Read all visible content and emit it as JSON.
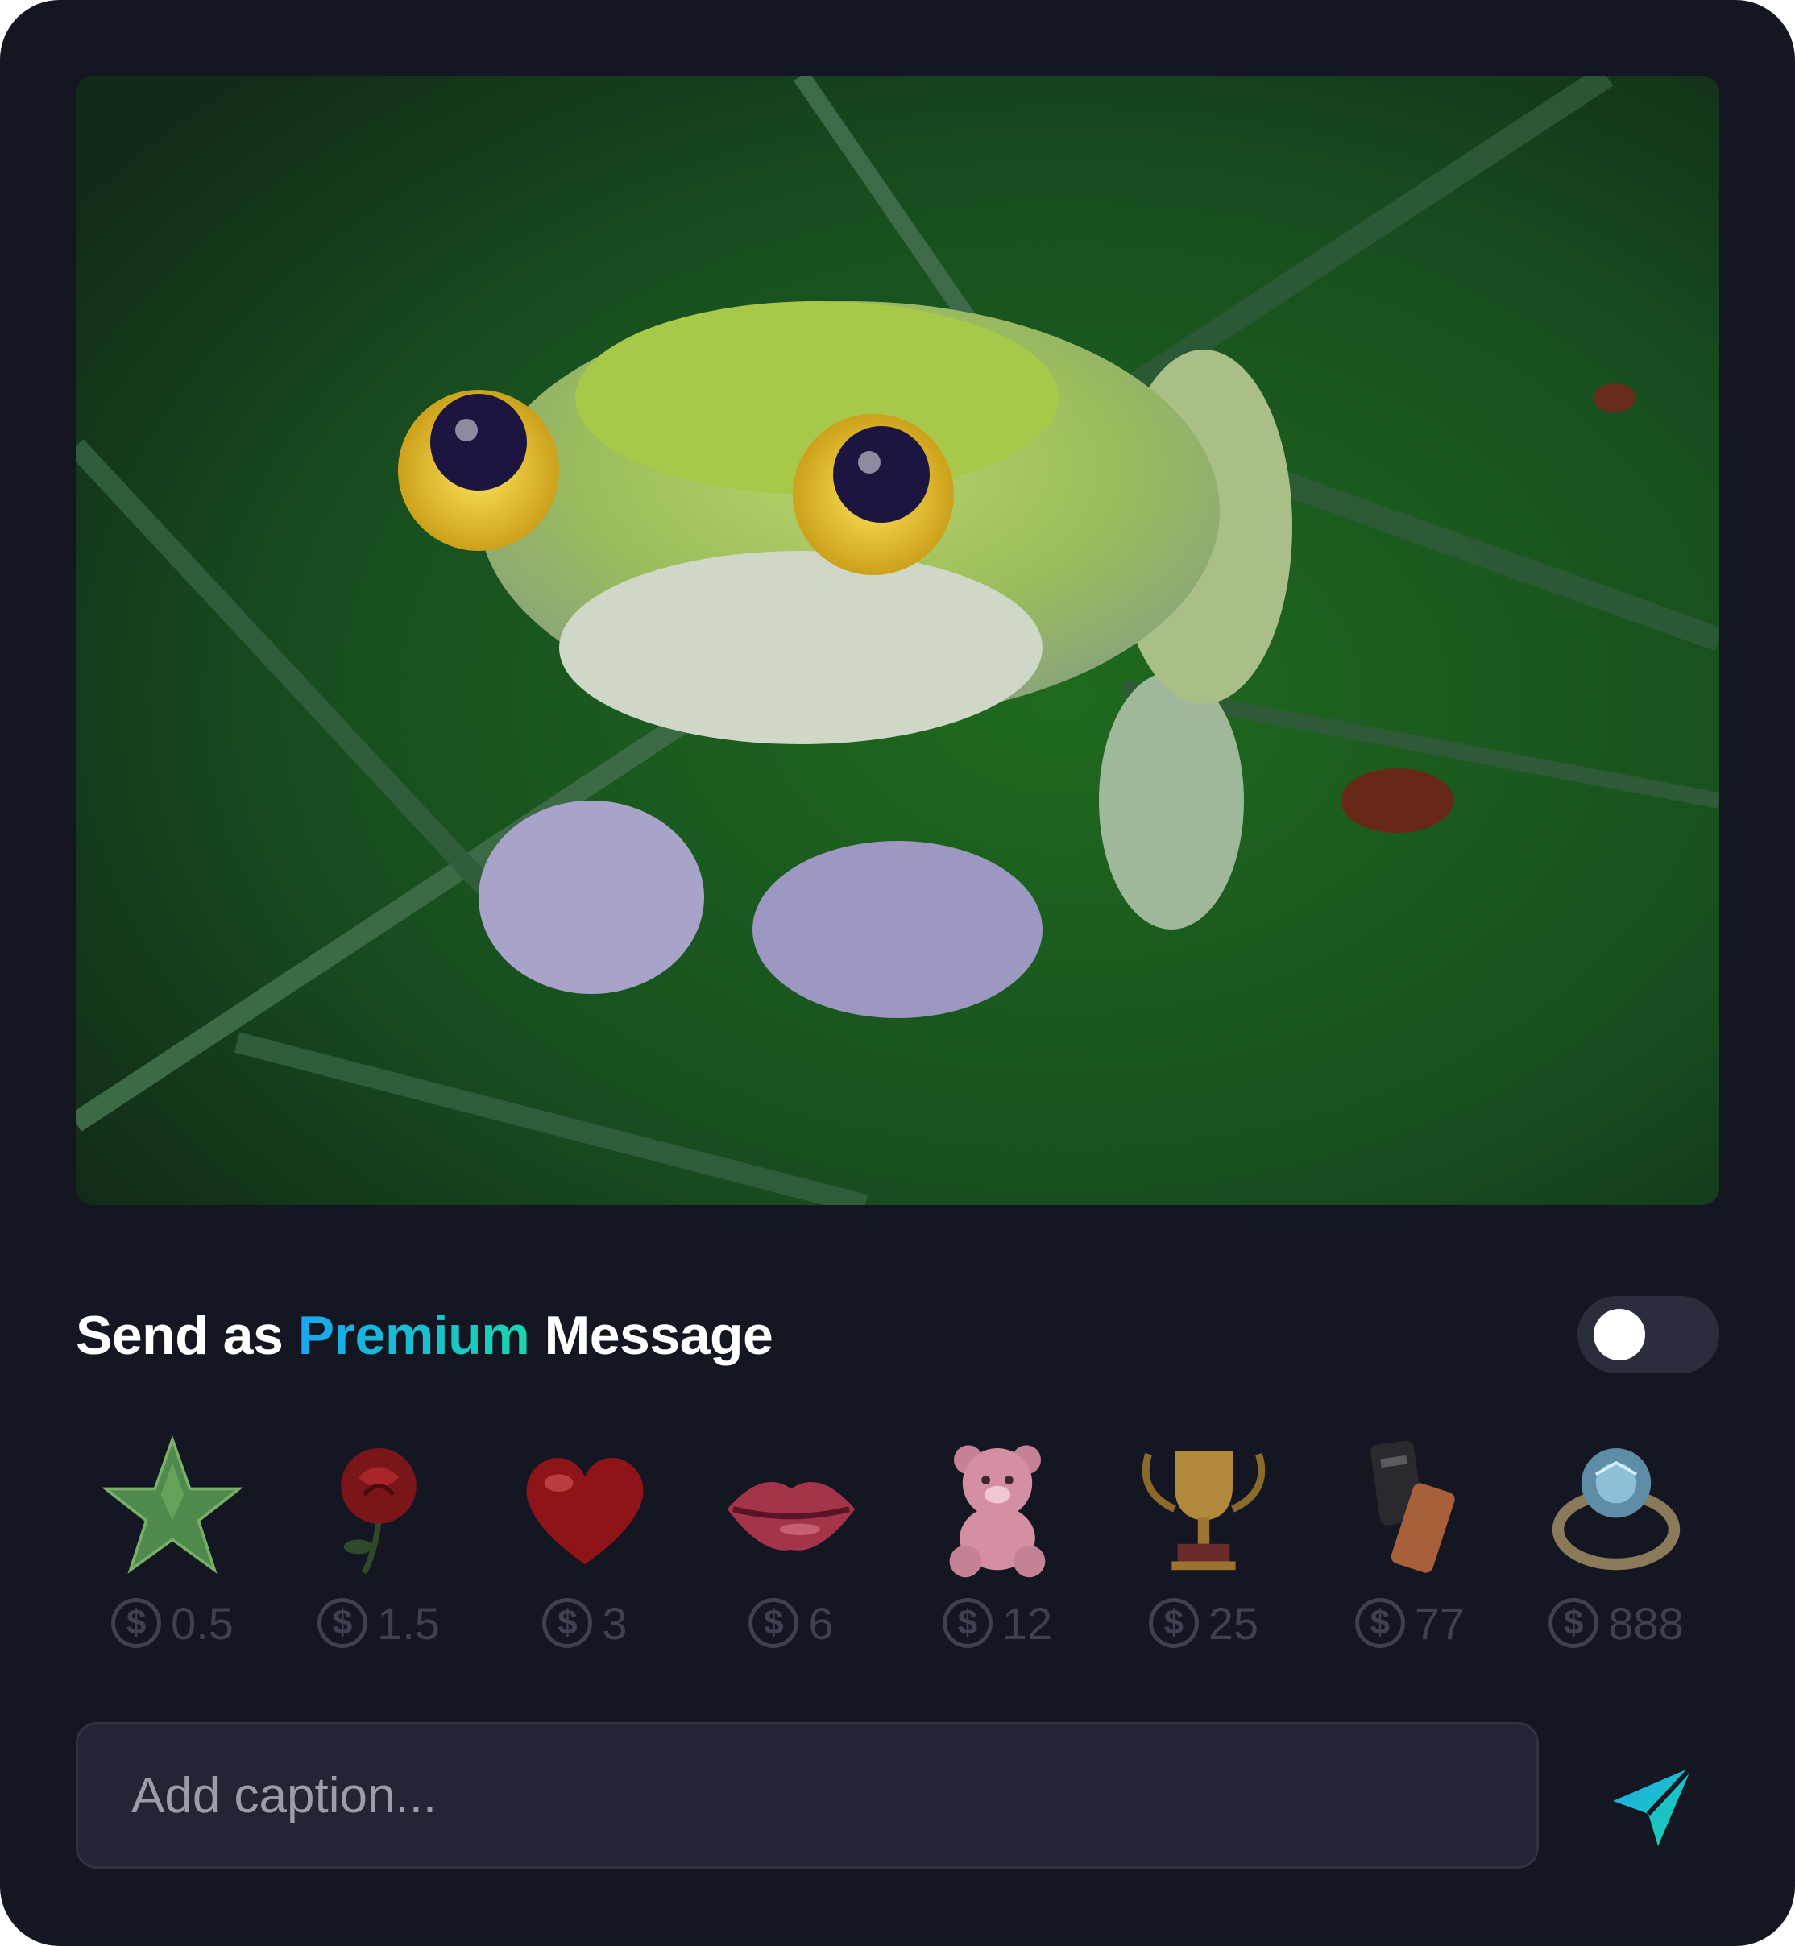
{
  "photo": {
    "subject": "frog-on-leaf-photo"
  },
  "premium": {
    "prefix": "Send as",
    "highlight": "Premium",
    "suffix": "Message",
    "toggle_on": false,
    "accent": "#19b7e6"
  },
  "gifts": [
    {
      "icon": "star-icon",
      "price": "0.5"
    },
    {
      "icon": "rose-icon",
      "price": "1.5"
    },
    {
      "icon": "heart-icon",
      "price": "3"
    },
    {
      "icon": "lips-icon",
      "price": "6"
    },
    {
      "icon": "teddy-bear-icon",
      "price": "12"
    },
    {
      "icon": "trophy-icon",
      "price": "25"
    },
    {
      "icon": "phone-icon",
      "price": "77"
    },
    {
      "icon": "ring-icon",
      "price": "888"
    }
  ],
  "coin_symbol": "$",
  "caption": {
    "placeholder": "Add caption...",
    "value": ""
  },
  "send": {
    "icon": "send-icon",
    "colors": [
      "#1ea6f2",
      "#17d6a3"
    ]
  }
}
